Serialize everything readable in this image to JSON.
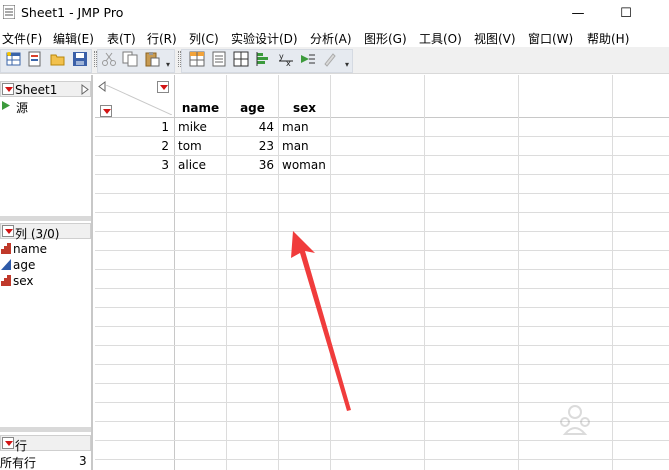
{
  "window": {
    "title": "Sheet1 - JMP Pro",
    "minimize": "—",
    "maximize": "☐",
    "close": ""
  },
  "menu": [
    {
      "id": "file",
      "label": "文件(F)"
    },
    {
      "id": "edit",
      "label": "编辑(E)"
    },
    {
      "id": "table",
      "label": "表(T)"
    },
    {
      "id": "rows",
      "label": "行(R)"
    },
    {
      "id": "cols",
      "label": "列(C)"
    },
    {
      "id": "doe",
      "label": "实验设计(D)"
    },
    {
      "id": "analyze",
      "label": "分析(A)"
    },
    {
      "id": "graph",
      "label": "图形(G)"
    },
    {
      "id": "tools",
      "label": "工具(O)"
    },
    {
      "id": "view",
      "label": "视图(V)"
    },
    {
      "id": "window",
      "label": "窗口(W)"
    },
    {
      "id": "help",
      "label": "帮助(H)"
    }
  ],
  "table_panel": {
    "name": "Sheet1",
    "source_label": "源"
  },
  "columns_panel": {
    "header": "列 (3/0)",
    "columns": [
      {
        "name": "name",
        "type": "nominal"
      },
      {
        "name": "age",
        "type": "continuous"
      },
      {
        "name": "sex",
        "type": "nominal"
      }
    ]
  },
  "rows_panel": {
    "header": "行",
    "all_rows_label": "所有行",
    "all_rows_count": "3"
  },
  "grid": {
    "headers": [
      "name",
      "age",
      "sex"
    ],
    "rows": [
      {
        "num": "1",
        "name": "mike",
        "age": "44",
        "sex": "man"
      },
      {
        "num": "2",
        "name": "tom",
        "age": "23",
        "sex": "man"
      },
      {
        "num": "3",
        "name": "alice",
        "age": "36",
        "sex": "woman"
      }
    ]
  },
  "colors": {
    "arrow": "#f03c3c",
    "toolbar_bg": "#e6eaf0",
    "dropdown_triangle": "#d21414"
  }
}
